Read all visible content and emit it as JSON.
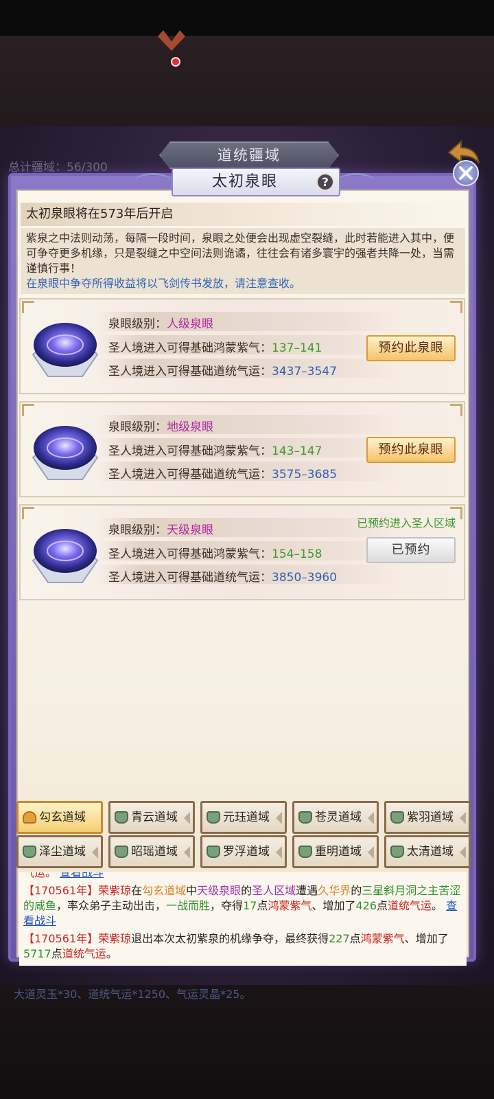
{
  "background": {
    "title": "道统疆域",
    "total_label": "总计疆域：56/300",
    "rewards_text": "大道灵玉*30、道统气运*1250、气运灵晶*25。"
  },
  "modal": {
    "title": "太初泉眼",
    "open_notice": "太初泉眼将在573年后开启",
    "description": "紫泉之中法则动荡，每隔一段时间，泉眼之处便会出现虚空裂缝，此时若能进入其中，便可争夺更多机缘，只是裂缝之中空间法则诡谲，往往会有诸多寰宇的强者共降一处，当需谨慎行事！",
    "description_note": "在泉眼中争夺所得收益将以飞剑传书发放，请注意查收。"
  },
  "springs": [
    {
      "level_label": "泉眼级别：",
      "level_value": "人级泉眼",
      "qi_label": "圣人境进入可得基础鸿蒙紫气：",
      "qi_value": "137–141",
      "luck_label": "圣人境进入可得基础道统气运：",
      "luck_value": "3437–3547",
      "button": "预约此泉眼"
    },
    {
      "level_label": "泉眼级别：",
      "level_value": "地级泉眼",
      "qi_label": "圣人境进入可得基础鸿蒙紫气：",
      "qi_value": "143–147",
      "luck_label": "圣人境进入可得基础道统气运：",
      "luck_value": "3575–3685",
      "button": "预约此泉眼"
    },
    {
      "level_label": "泉眼级别：",
      "level_value": "天级泉眼",
      "qi_label": "圣人境进入可得基础鸿蒙紫气：",
      "qi_value": "154–158",
      "luck_label": "圣人境进入可得基础道统气运：",
      "luck_value": "3850–3960",
      "button": "已预约",
      "reserved_note": "已预约进入圣人区域"
    }
  ],
  "tabs": [
    {
      "label": "勾玄道域",
      "active": true
    },
    {
      "label": "青云道域"
    },
    {
      "label": "元珏道域"
    },
    {
      "label": "苍灵道域"
    },
    {
      "label": "紫羽道域"
    },
    {
      "label": "泽尘道域"
    },
    {
      "label": "昭瑶道域"
    },
    {
      "label": "罗浮道域"
    },
    {
      "label": "重明道域"
    },
    {
      "label": "太清道域"
    }
  ],
  "log": {
    "cut_line": {
      "a": "气运。",
      "link": "查看战斗"
    },
    "entry1": {
      "year": "【170561年】",
      "name": "荣紫琼",
      "t1": "在",
      "domain": "勾玄道域",
      "t2": "中",
      "spring": "天级泉眼",
      "t3": "的",
      "area": "圣人区域",
      "t4": "遭遇",
      "realm": "久华界",
      "t5": "的",
      "enemy": "三星斜月洞之主苦涩的咸鱼",
      "t6": "，率众弟子主动出击，",
      "result": "一战而胜",
      "t7": "，夺得",
      "qi_points": "17",
      "t8": "点",
      "qi": "鸿蒙紫气",
      "t9": "、增加了",
      "luck_points": "426",
      "t10": "点",
      "luck": "道统气运",
      "t11": "。",
      "link": "查看战斗"
    },
    "entry2": {
      "year": "【170561年】",
      "name": "荣紫琼",
      "t1": "退出本次太初紫泉的机缘争夺，最终获得",
      "qi_points": "227",
      "t2": "点",
      "qi": "鸿蒙紫气",
      "t3": "、增加了",
      "luck_points": "5717",
      "t4": "点",
      "luck": "道统气运",
      "t5": "。"
    }
  },
  "colors": {
    "purple_level": "#b02aa5",
    "green_value": "#3d9a2e",
    "blue_value": "#2f5db6",
    "reserve_button": "#f5c46b",
    "log_red": "#c8261f"
  }
}
